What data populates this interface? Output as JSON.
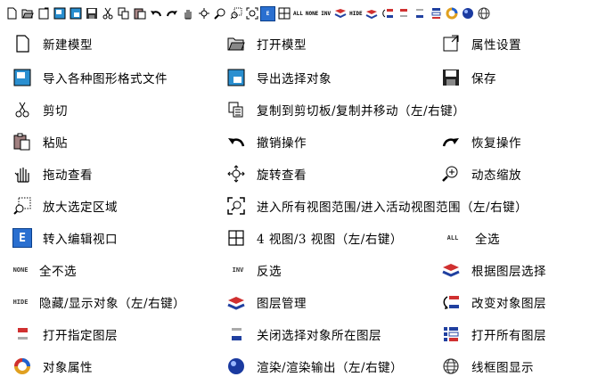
{
  "toolbar": {
    "icons": [
      "new-icon",
      "open-icon",
      "properties-icon",
      "import-icon",
      "export-icon",
      "save-icon",
      "cut-icon",
      "copy-icon",
      "paste-icon",
      "undo-icon",
      "redo-icon",
      "pan-icon",
      "rotate-icon",
      "zoom-icon",
      "zoom-window-icon",
      "zoom-extents-icon",
      "edit-viewport-icon",
      "four-viewports-icon",
      "select-all-icon",
      "select-none-icon",
      "invert-select-icon",
      "layer-select-icon",
      "hide-icon",
      "layer-manager-icon",
      "change-layer-icon",
      "open-layer-icon",
      "close-layer-icon",
      "open-all-layers-icon",
      "object-properties-icon",
      "render-icon",
      "wireframe-icon"
    ],
    "all_label": "ALL",
    "none_label": "NONE",
    "inv_label": "INV",
    "hide_label": "HIDE"
  },
  "items": {
    "new_model": "新建模型",
    "open_model": "打开模型",
    "properties": "属性设置",
    "import": "导入各种图形格式文件",
    "export": "导出选择对象",
    "save": "保存",
    "cut": "剪切",
    "copy_move": "复制到剪切板/复制并移动（左/右键）",
    "paste": "粘贴",
    "undo": "撤销操作",
    "redo": "恢复操作",
    "pan": "拖动查看",
    "rotate": "旋转查看",
    "zoom": "动态缩放",
    "zoom_region": "放大选定区域",
    "zoom_all": "进入所有视图范围/进入活动视图范围（左/右键）",
    "edit_viewport": "转入编辑视口",
    "four_views": "4 视图/3 视图（左/右键）",
    "select_all": "全选",
    "select_none": "全不选",
    "invert_select": "反选",
    "select_by_layer": "根据图层选择",
    "hide_show": "隐藏/显示对象（左/右键）",
    "layer_manager": "图层管理",
    "change_layer": "改变对象图层",
    "open_layer": "打开指定图层",
    "close_layer": "关闭选择对象所在图层",
    "open_all_layers": "打开所有图层",
    "object_properties": "对象属性",
    "render": "渲染/渲染输出（左/右键）",
    "wireframe": "线框图显示"
  },
  "icon_text": {
    "all": "ALL",
    "none": "NONE",
    "inv": "INV",
    "hide": "HIDE",
    "e": "E"
  },
  "colors": {
    "accent": "#2a6fd0",
    "layer_red": "#d03030",
    "layer_blue": "#2040a0"
  }
}
